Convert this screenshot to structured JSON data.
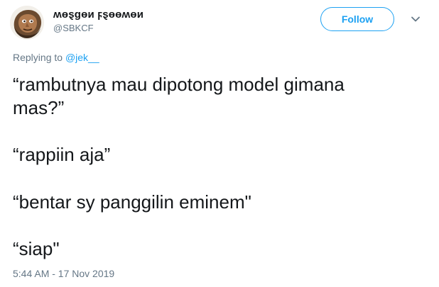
{
  "author": {
    "display_name": "ʍɵȿɡɵи ϝȿɵɵʍɵи",
    "handle": "@SBKCF",
    "avatar_icon": "caricature-face-icon"
  },
  "actions": {
    "follow_label": "Follow",
    "more_icon": "chevron-down-icon"
  },
  "reply": {
    "prefix": "Replying to ",
    "mention": "@jek__"
  },
  "tweet": {
    "lines": [
      "“rambutnya mau dipotong model gimana",
      "mas?”",
      "“rappiin aja”",
      "“bentar sy panggilin eminem\"",
      "“siap\""
    ],
    "timestamp": "5:44 AM - 17 Nov 2019"
  },
  "colors": {
    "accent": "#1da1f2",
    "text": "#14171a",
    "muted": "#657786"
  }
}
